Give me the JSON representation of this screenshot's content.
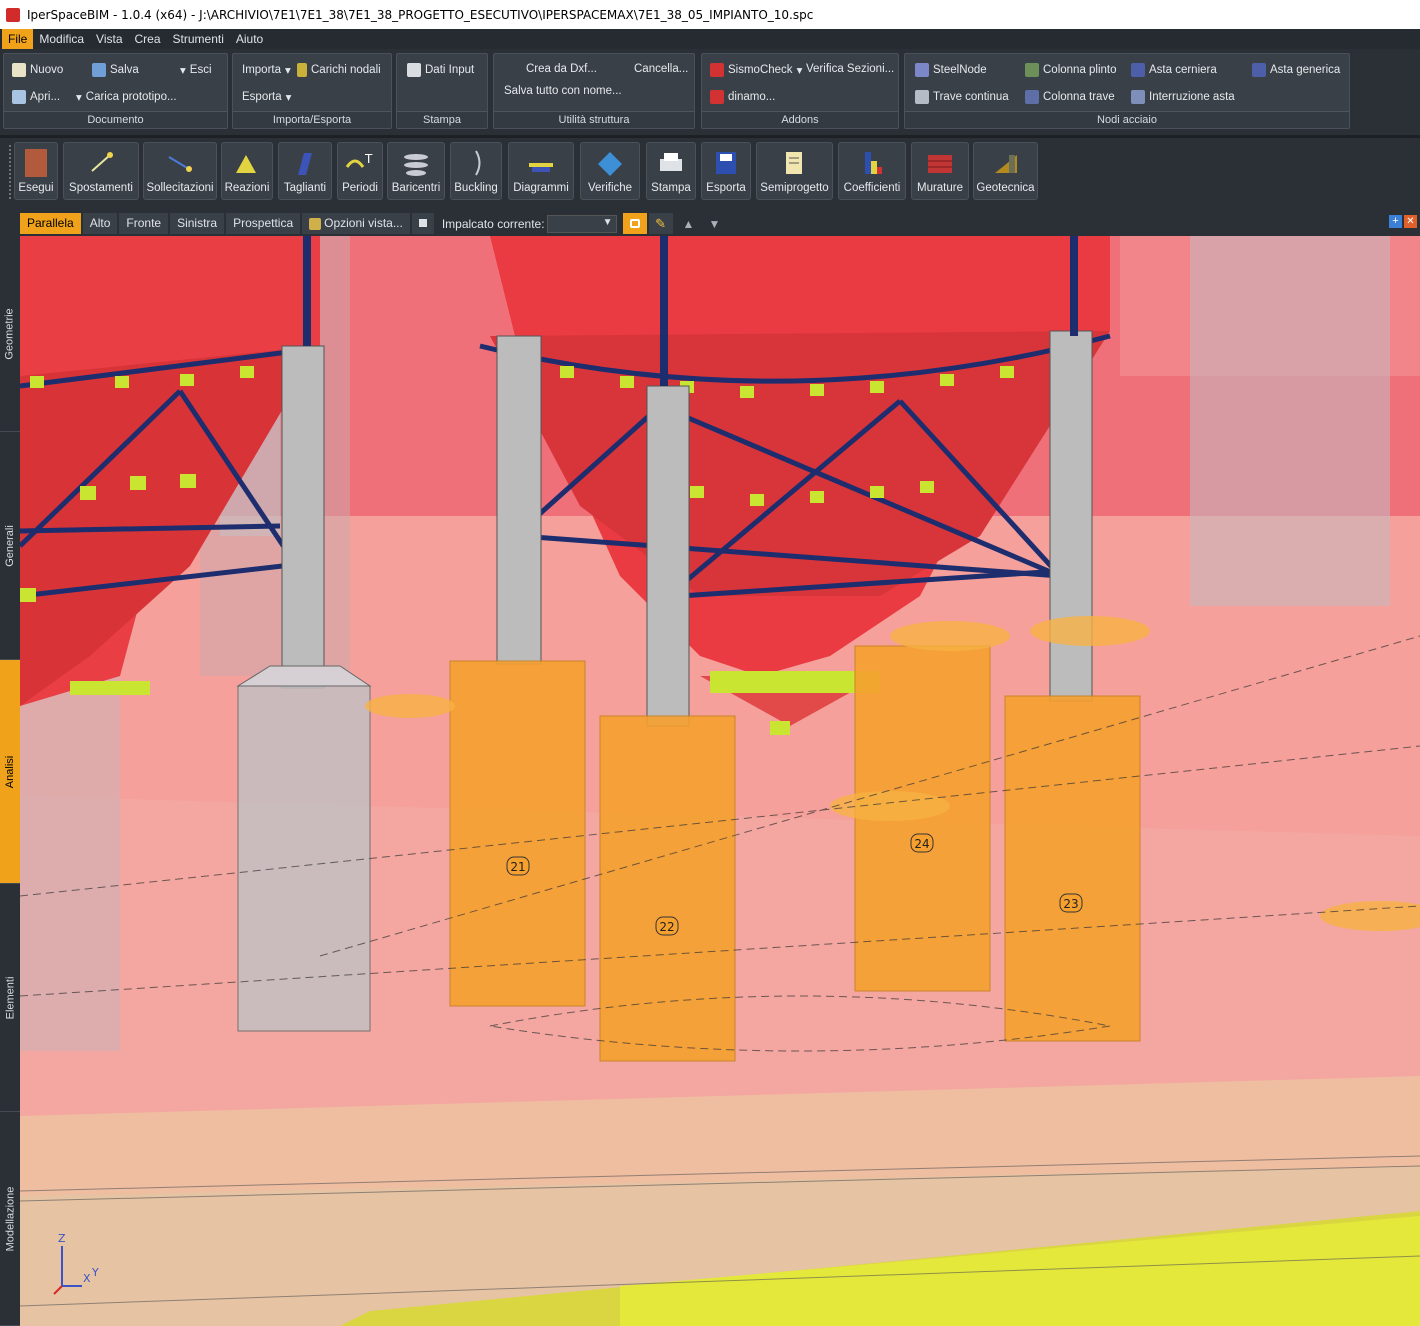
{
  "window": {
    "title": "IperSpaceBIM - 1.0.4 (x64) - J:\\ARCHIVIO\\7E1\\7E1_38\\7E1_38_PROGETTO_ESECUTIVO\\IPERSPACEMAX\\7E1_38_05_IMPIANTO_10.spc"
  },
  "menu": [
    "File",
    "Modifica",
    "Vista",
    "Crea",
    "Strumenti",
    "Aiuto"
  ],
  "ribbon": {
    "documento": {
      "title": "Documento",
      "nuovo": "Nuovo",
      "salva": "Salva",
      "esci": "Esci",
      "apri": "Apri...",
      "carica": "Carica prototipo..."
    },
    "importa": {
      "title": "Importa/Esporta",
      "importa": "Importa",
      "carichi": "Carichi nodali",
      "esporta": "Esporta"
    },
    "stampa": {
      "title": "Stampa",
      "dati": "Dati Input"
    },
    "utilita": {
      "title": "Utilità struttura",
      "crea_dxf": "Crea da Dxf...",
      "cancella": "Cancella...",
      "salva_tutto": "Salva tutto con nome..."
    },
    "addons": {
      "title": "Addons",
      "sismo": "SismoCheck",
      "verifica": "Verifica Sezioni...",
      "dinamo": "dinamo..."
    },
    "nodi": {
      "title": "Nodi acciaio",
      "steelnode": "SteelNode",
      "colonna_plinto": "Colonna plinto",
      "asta_cerniera": "Asta cerniera",
      "asta_generica": "Asta generica",
      "trave_continua": "Trave continua",
      "colonna_trave": "Colonna trave",
      "interruzione": "Interruzione asta"
    }
  },
  "toolbar": [
    "Esegui",
    "Spostamenti",
    "Sollecitazioni",
    "Reazioni",
    "Taglianti",
    "Periodi",
    "Baricentri",
    "Buckling",
    "Diagrammi",
    "Verifiche",
    "Stampa",
    "Esporta",
    "Semiprogetto",
    "Coefficienti",
    "Murature",
    "Geotecnica"
  ],
  "viewbar": {
    "tabs": [
      "Parallela",
      "Alto",
      "Fronte",
      "Sinistra",
      "Prospettica"
    ],
    "opzioni": "Opzioni vista...",
    "impalcato": "Impalcato corrente:"
  },
  "sidebar": [
    "Geometrie",
    "Generali",
    "Analisi",
    "Elementi",
    "Modellazione"
  ],
  "viewport": {
    "labels": [
      "21",
      "22",
      "24",
      "23"
    ],
    "axes": {
      "z": "Z",
      "x": "X",
      "y": "Y"
    }
  },
  "colors": {
    "accent": "#f0a31a",
    "silo": "#e8464a",
    "plinth": "#f7a431",
    "ground": "#f4a39b"
  }
}
